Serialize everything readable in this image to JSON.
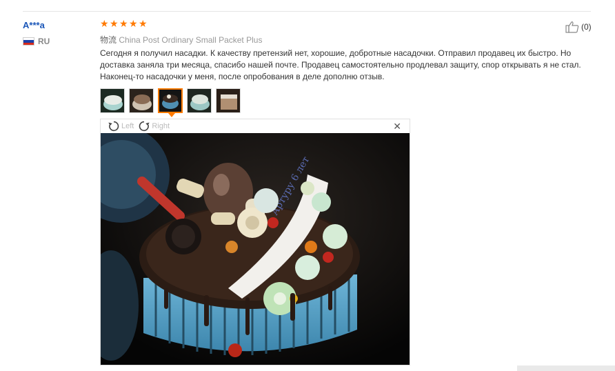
{
  "review": {
    "user_name": "A***a",
    "country_code": "RU",
    "rating": 5,
    "logistics_label": "物流",
    "logistics_value": "China Post Ordinary Small Packet Plus",
    "text": "Сегодня я получил насадки. К качеству претензий нет, хорошие, добротные насадочки. Отправил продавец их быстро. Но доставка заняла три месяца, спасибо нашей почте. Продавец самостоятельно продлевал защиту, спор открывать я не стал. Наконец-то насадочки у меня, после опробования в деле дополню отзыв.",
    "like_count": "(0)"
  },
  "viewer": {
    "rotate_left_label": "Left",
    "rotate_right_label": "Right",
    "close_icon": "close-icon"
  },
  "thumbnails": [
    {
      "name": "photo-thumb-1",
      "active": false
    },
    {
      "name": "photo-thumb-2",
      "active": false
    },
    {
      "name": "photo-thumb-3",
      "active": true
    },
    {
      "name": "photo-thumb-4",
      "active": false
    },
    {
      "name": "photo-thumb-5",
      "active": false
    }
  ],
  "colors": {
    "accent": "#ff7a00",
    "user_link": "#1a56b8"
  }
}
